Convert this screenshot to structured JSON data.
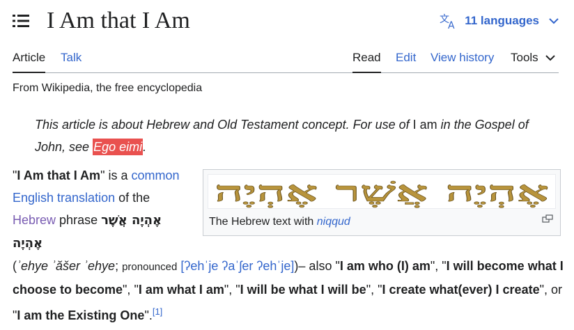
{
  "header": {
    "title": "I Am that I Am",
    "languages_label": "11 languages"
  },
  "tabs": {
    "article": "Article",
    "talk": "Talk",
    "read": "Read",
    "edit": "Edit",
    "view_history": "View history",
    "tools": "Tools"
  },
  "tagline": "From Wikipedia, the free encyclopedia",
  "hatnote": {
    "part1": "This article is about Hebrew and Old Testament concept. For use of ",
    "i_am": "I am",
    "part2": " in the Gospel of John, see ",
    "link": "Ego eimi",
    "end": "."
  },
  "figure": {
    "hebrew_image_text": "אֶהְיֶה אֲשֶׁר אֶהְיֶה",
    "caption_prefix": "The Hebrew text with ",
    "caption_link": "niqqud"
  },
  "body": {
    "q1": "\"",
    "bold_title": "I Am that I Am",
    "q2": "\" is a",
    "link_common": "common English translation",
    "of_the": " of the ",
    "link_hebrew": "Hebrew",
    "phrase": " phrase ",
    "hebrew_phrase": "אֶהְיֶה אֲשֶׁר אֶהְיֶה",
    "paren_open": "(",
    "translit": "ʾehye ʾăšer ʾehye",
    "semicolon": "; ",
    "pronounced": "pronounced",
    "ipa": "[ʔehˈje ʔaˈʃer ʔehˈje]",
    "after_ipa": ")– also \"",
    "alt1": "I am who (I) am",
    "sep1": "\", \"",
    "alt2": "I will become what I choose to become",
    "sep2": "\", \"",
    "alt3": "I am what I am",
    "sep3": "\", \"",
    "alt4": "I will be what I will be",
    "sep4": "\", \"",
    "alt5": "I create what(ever) I create",
    "sep5": "\", or \"",
    "alt6": "I am the Existing One",
    "end": "\".",
    "ref": "[1]"
  },
  "colors": {
    "link": "#3366cc",
    "visited_link": "#795cb2",
    "highlight": "#e9514f",
    "text": "#202122",
    "hebrew_gold": "#b8943c"
  }
}
